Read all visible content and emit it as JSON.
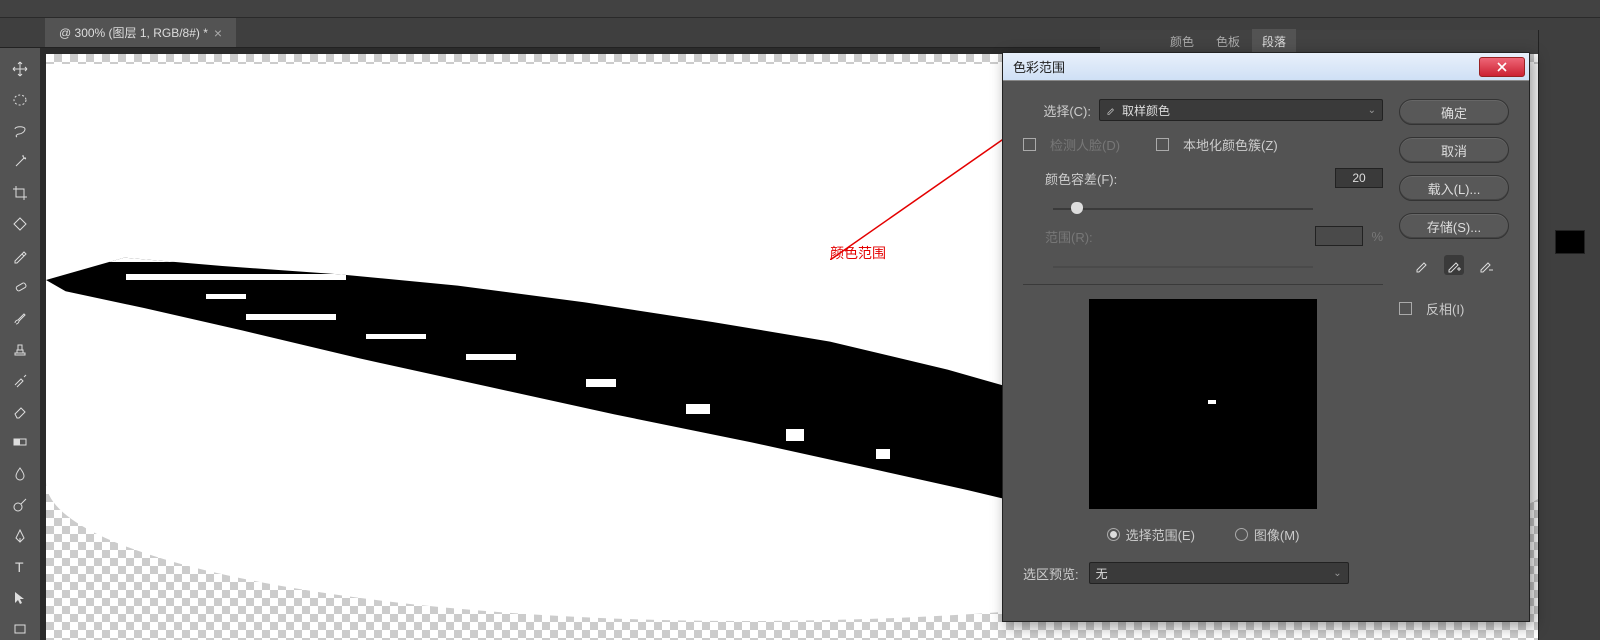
{
  "tab": {
    "title": "@ 300% (图层 1, RGB/8#) *"
  },
  "annotation": "颜色范围",
  "panel_tabs": [
    "颜色",
    "色板",
    "段落"
  ],
  "dialog": {
    "title": "色彩范围",
    "select_label": "选择(C):",
    "select_value": "取样颜色",
    "detect_faces": "检测人脸(D)",
    "localized": "本地化颜色簇(Z)",
    "fuzziness_label": "颜色容差(F):",
    "fuzziness_value": "20",
    "range_label": "范围(R):",
    "range_unit": "%",
    "radio_selection": "选择范围(E)",
    "radio_image": "图像(M)",
    "preview_label": "选区预览:",
    "preview_value": "无",
    "buttons": {
      "ok": "确定",
      "cancel": "取消",
      "load": "载入(L)...",
      "save": "存储(S)..."
    },
    "invert": "反相(I)"
  },
  "tools": [
    "move",
    "marquee-ellipse",
    "lasso",
    "wand",
    "crop",
    "slice",
    "eyedropper",
    "healing",
    "brush",
    "stamp",
    "history-brush",
    "eraser",
    "gradient",
    "blur",
    "dodge",
    "pen",
    "type",
    "path-select",
    "rectangle"
  ]
}
